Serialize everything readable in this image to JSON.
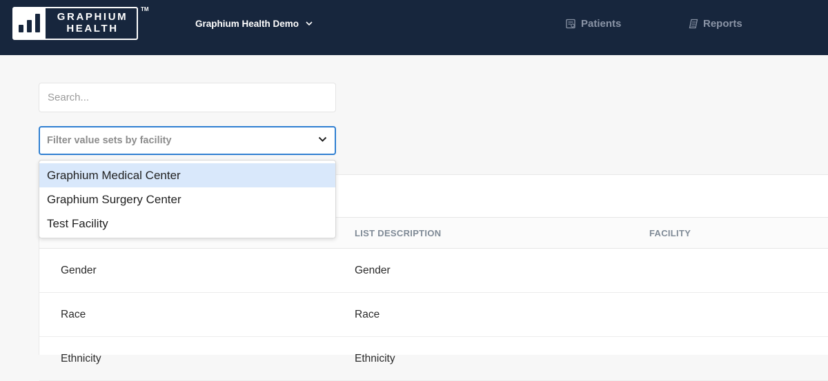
{
  "header": {
    "logo": {
      "line1": "GRAPHIUM",
      "line2": "HEALTH",
      "tm": "TM"
    },
    "org_selector": {
      "label": "Graphium Health Demo",
      "icon": "chevron-down-icon"
    },
    "nav": [
      {
        "label": "Patients",
        "icon": "patients-list-icon"
      },
      {
        "label": "Reports",
        "icon": "reports-icon"
      }
    ],
    "colors": {
      "background": "#17263d",
      "nav_text": "#8a94a6"
    }
  },
  "search": {
    "placeholder": "Search...",
    "value": ""
  },
  "filter": {
    "placeholder": "Filter value sets by facility",
    "focus_color": "#2f7fd1",
    "options": [
      {
        "label": "Graphium Medical Center",
        "highlighted": true
      },
      {
        "label": "Graphium Surgery Center",
        "highlighted": false
      },
      {
        "label": "Test Facility",
        "highlighted": false
      }
    ]
  },
  "table": {
    "headers": [
      "",
      "LIST DESCRIPTION",
      "FACILITY"
    ],
    "rows": [
      {
        "name": "Gender",
        "description": "Gender",
        "facility": ""
      },
      {
        "name": "Race",
        "description": "Race",
        "facility": ""
      },
      {
        "name": "Ethnicity",
        "description": "Ethnicity",
        "facility": ""
      }
    ]
  }
}
